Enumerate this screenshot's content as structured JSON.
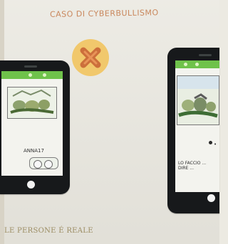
{
  "page": {
    "title": "CASO DI CYBERBULLISMO",
    "caption": "LE PERSONE É REALE"
  },
  "left_phone": {
    "screen_label": "ANNA17"
  },
  "right_phone": {
    "note_line_1": "LO FACCIO ...",
    "note_line_2": "DIRE ..."
  },
  "colors": {
    "app_green": "#6fc24b",
    "phone_black": "#17191b",
    "emblem_yellow": "#f1c86c",
    "emblem_mark": "#cc6f3b",
    "title_text": "#c9875d",
    "caption_text": "#9b8c62"
  }
}
